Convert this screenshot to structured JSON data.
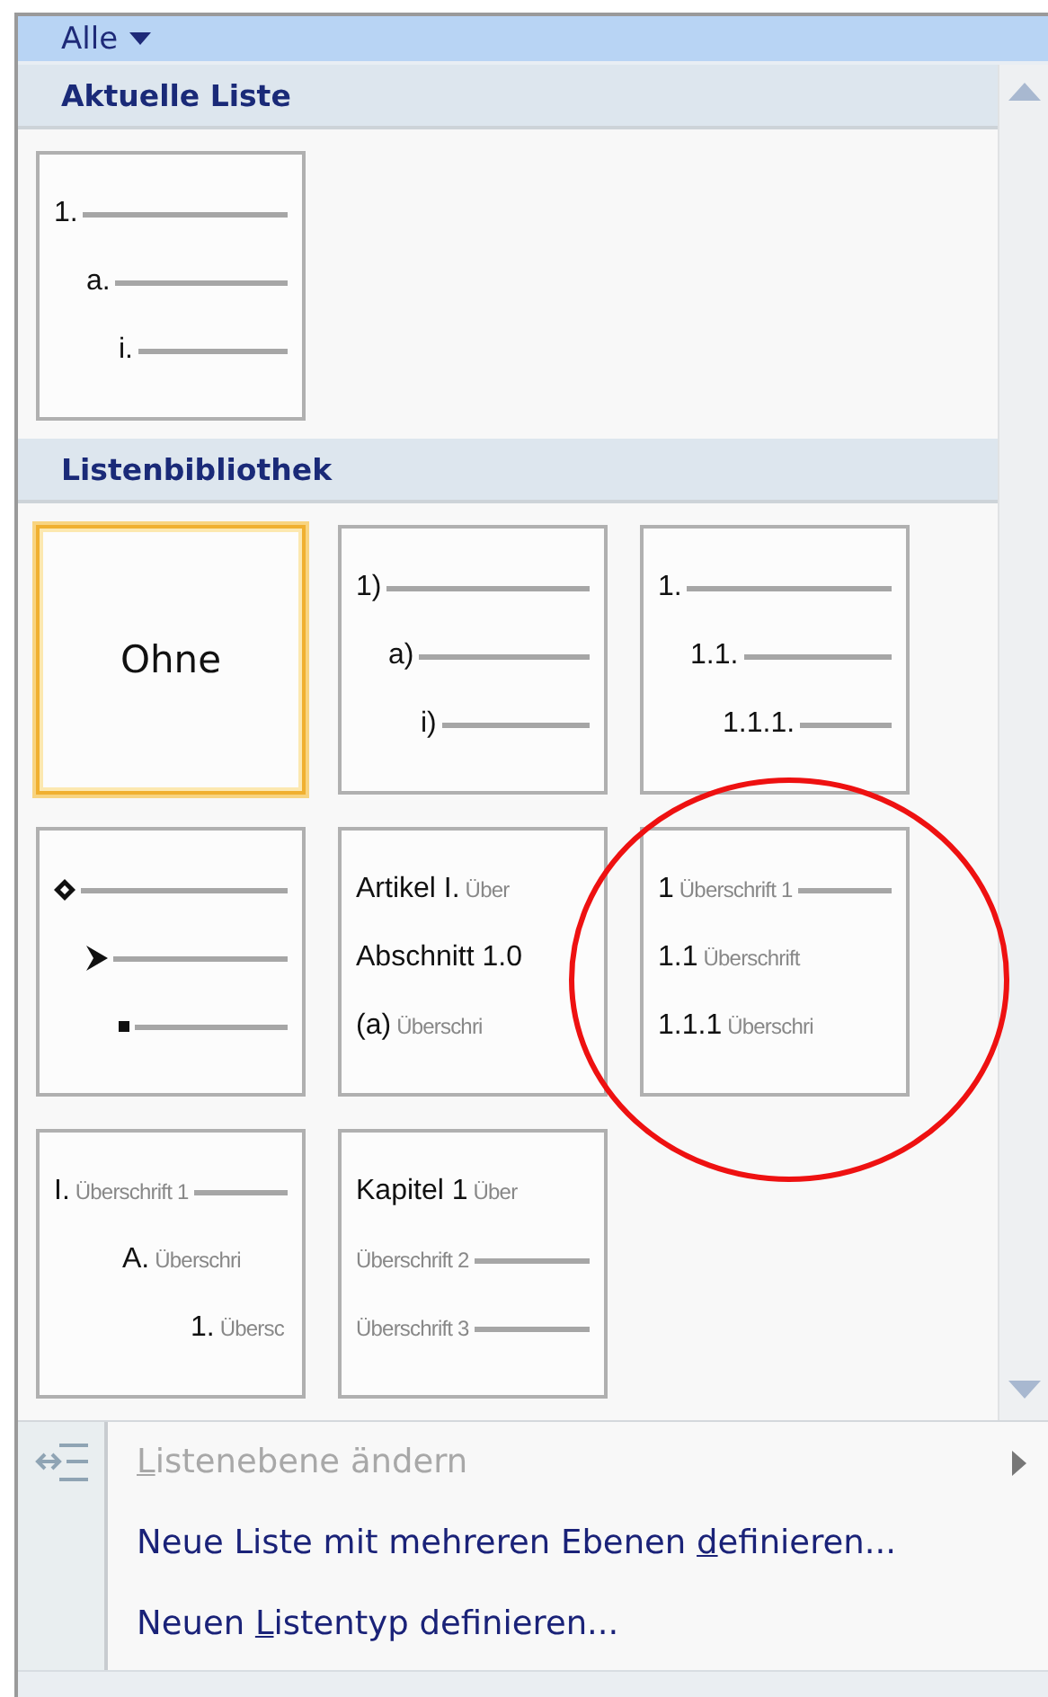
{
  "filter": {
    "label": "Alle"
  },
  "sections": [
    {
      "title": "Aktuelle Liste",
      "cards": [
        {
          "kind": "list",
          "selected": false,
          "lines": [
            {
              "label": "1.",
              "rule": true,
              "children": [
                {
                  "label": "a.",
                  "rule": true,
                  "children": [
                    {
                      "label": "i.",
                      "rule": true
                    }
                  ]
                }
              ]
            }
          ]
        }
      ]
    },
    {
      "title": "Listenbibliothek",
      "cards": [
        {
          "kind": "none",
          "selected": true,
          "label": "Ohne"
        },
        {
          "kind": "list",
          "selected": false,
          "lines": [
            {
              "label": "1)",
              "rule": true,
              "children": [
                {
                  "label": "a)",
                  "rule": true,
                  "children": [
                    {
                      "label": "i)",
                      "rule": true
                    }
                  ]
                }
              ]
            }
          ]
        },
        {
          "kind": "list",
          "selected": false,
          "lines": [
            {
              "label": "1.",
              "rule": true,
              "children": [
                {
                  "label": "1.1.",
                  "rule": true,
                  "children": [
                    {
                      "label": "1.1.1.",
                      "rule": true
                    }
                  ]
                }
              ]
            }
          ]
        },
        {
          "kind": "list",
          "selected": false,
          "lines": [
            {
              "kind": "bullet",
              "rule": true,
              "children": [
                {
                  "kind": "bullet",
                  "rule": true,
                  "children": [
                    {
                      "kind": "bullet",
                      "rule": true
                    }
                  ]
                }
              ]
            }
          ]
        },
        {
          "kind": "list",
          "selected": false,
          "lines": [
            {
              "label": "Artikel I.",
              "heading": "Über"
            },
            {
              "label": "Abschnitt 1.0"
            },
            {
              "label": "(a)",
              "heading": "Überschri"
            }
          ]
        },
        {
          "kind": "list",
          "selected": false,
          "lines": [
            {
              "label": "1",
              "heading": "Überschrift 1",
              "rule": true
            },
            {
              "label": "1.1",
              "heading": "Überschrift"
            },
            {
              "label": "1.1.1",
              "heading": "Überschri"
            }
          ]
        },
        {
          "kind": "list",
          "selected": false,
          "lines": [
            {
              "label": "I.",
              "heading": "Überschrift 1",
              "rule": true,
              "children": [
                {
                  "label": "A.",
                  "heading": "Überschri",
                  "children": [
                    {
                      "label": "1.",
                      "heading": "Übersc"
                    }
                  ]
                }
              ]
            }
          ]
        },
        {
          "kind": "list",
          "selected": false,
          "lines": [
            {
              "label": "Kapitel 1",
              "heading": "Über"
            },
            {
              "heading": "Überschrift 2",
              "rule": true
            },
            {
              "heading": "Überschrift 3",
              "rule": true
            }
          ]
        }
      ]
    }
  ],
  "annotation": {
    "kind": "circle"
  },
  "menu": [
    {
      "key": "L",
      "after": "istenebene ändern",
      "disabled": true,
      "submenu": true
    },
    {
      "before": "Neue Liste mit mehreren Ebenen ",
      "key": "d",
      "after": "efinieren...",
      "disabled": false,
      "submenu": false
    },
    {
      "before": "Neuen ",
      "key": "L",
      "after": "istentyp definieren...",
      "disabled": false,
      "submenu": false
    }
  ]
}
